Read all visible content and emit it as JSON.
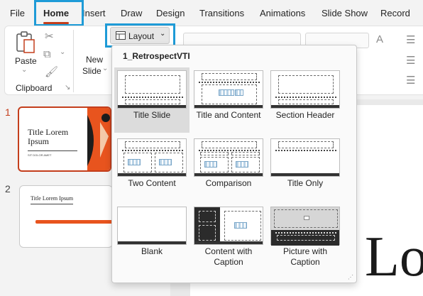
{
  "menu": {
    "tabs": [
      "File",
      "Home",
      "Insert",
      "Draw",
      "Design",
      "Transitions",
      "Animations",
      "Slide Show",
      "Record"
    ],
    "active": "Home"
  },
  "ribbon": {
    "paste_label": "Paste",
    "clipboard_label": "Clipboard",
    "new_slide_label_1": "New",
    "new_slide_label_2": "Slide",
    "layout_label": "Layout"
  },
  "thumbnails": [
    {
      "number": "1",
      "title": "Title Lorem Ipsum",
      "subtitle": "SIT DOLOR AMET"
    },
    {
      "number": "2",
      "title": "Title Lorem Ipsum"
    }
  ],
  "editor": {
    "big_text": "Lo"
  },
  "layout_menu": {
    "theme_name": "1_RetrospectVTI",
    "items": [
      {
        "label_1": "Title Slide",
        "label_2": ""
      },
      {
        "label_1": "Title and Content",
        "label_2": ""
      },
      {
        "label_1": "Section Header",
        "label_2": ""
      },
      {
        "label_1": "Two Content",
        "label_2": ""
      },
      {
        "label_1": "Comparison",
        "label_2": ""
      },
      {
        "label_1": "Title Only",
        "label_2": ""
      },
      {
        "label_1": "Blank",
        "label_2": ""
      },
      {
        "label_1": "Content with",
        "label_2": "Caption"
      },
      {
        "label_1": "Picture with",
        "label_2": "Caption"
      }
    ]
  },
  "colors": {
    "accent": "#c43e1c",
    "highlight": "#1e9bd7"
  }
}
